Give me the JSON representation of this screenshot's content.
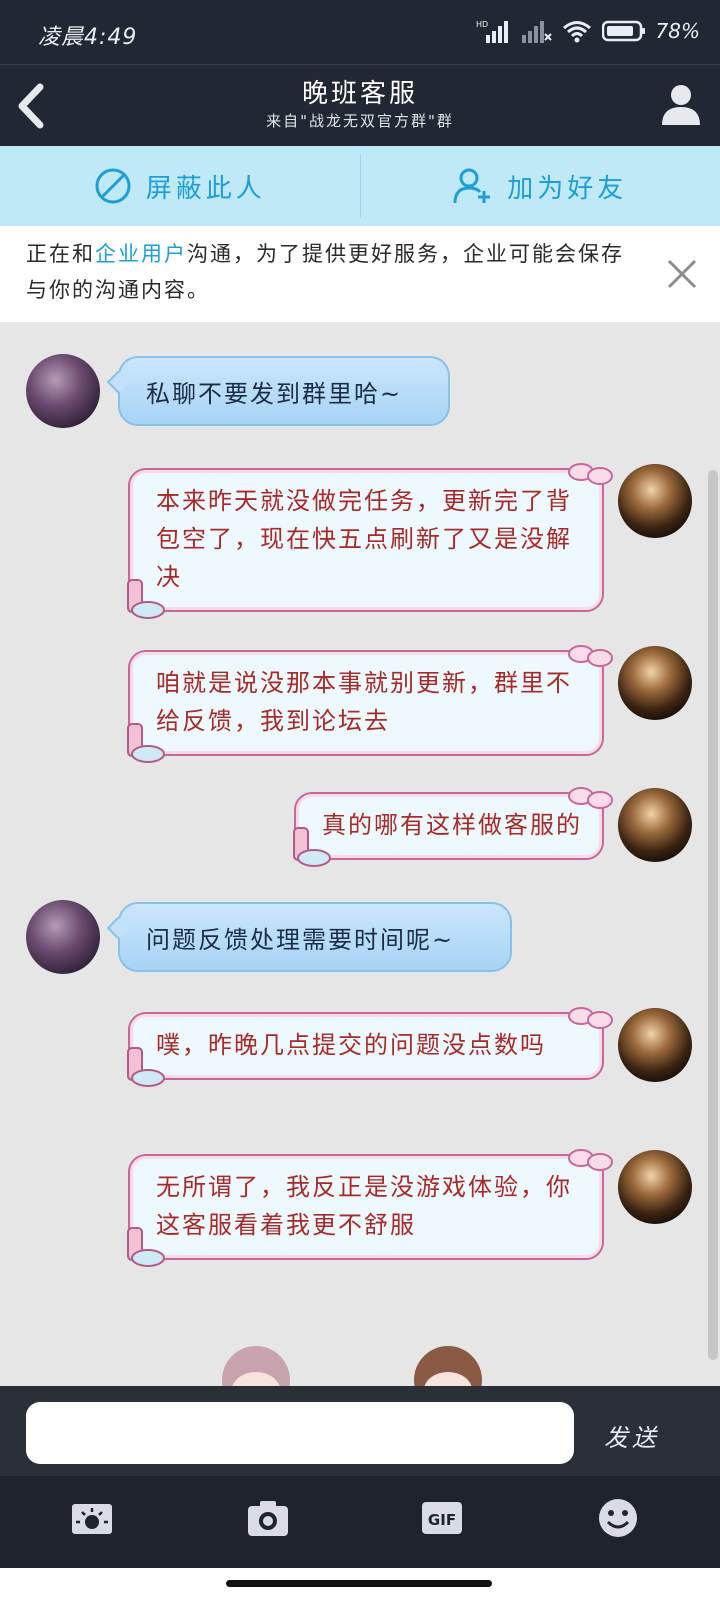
{
  "status_bar": {
    "time": "凌晨4:49",
    "battery": "78"
  },
  "header": {
    "title": "晚班客服",
    "subtitle": "来自\"战龙无双官方群\"群"
  },
  "actions": {
    "block_label": "屏蔽此人",
    "add_friend_label": "加为好友"
  },
  "notice": {
    "text_before": "正在和",
    "highlight": "企业用户",
    "text_after": "沟通，为了提供更好服务，企业可能会保存与你的沟通内容。"
  },
  "messages": [
    {
      "side": "in",
      "text": "私聊不要发到群里哈~"
    },
    {
      "side": "out",
      "text": "本来昨天就没做完任务，更新完了背包空了，现在快五点刷新了又是没解决"
    },
    {
      "side": "out",
      "text": "咱就是说没那本事就别更新，群里不给反馈，我到论坛去"
    },
    {
      "side": "out",
      "text": "真的哪有这样做客服的"
    },
    {
      "side": "in",
      "text": "问题反馈处理需要时间呢~"
    },
    {
      "side": "out",
      "text": "噗，昨晚几点提交的问题没点数吗"
    },
    {
      "side": "out",
      "text": "无所谓了，我反正是没游戏体验，你这客服看着我更不舒服"
    }
  ],
  "input": {
    "placeholder": "",
    "send_label": "发送"
  },
  "toolbar": {
    "icons": [
      "sun-icon",
      "camera-icon",
      "gif-icon",
      "emoji-icon"
    ],
    "gif_label": "GIF"
  }
}
